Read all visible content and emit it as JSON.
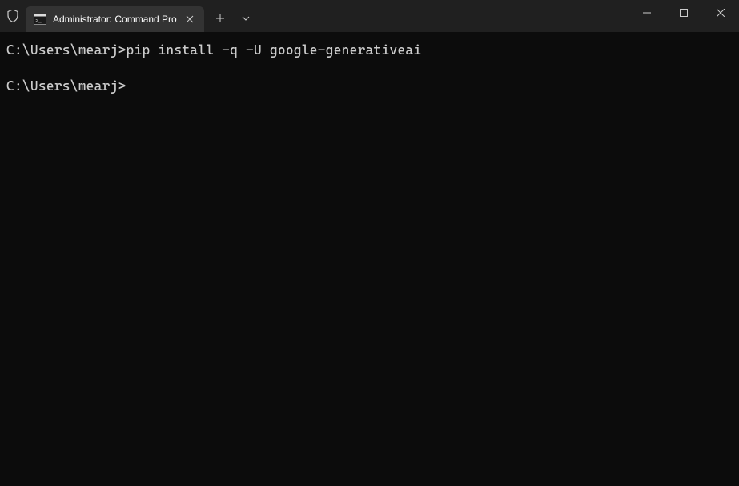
{
  "tab": {
    "title": "Administrator: Command Pro"
  },
  "terminal": {
    "lines": [
      {
        "prompt": "C:\\Users\\mearj>",
        "command": "pip install -q -U google-generativeai"
      },
      {
        "prompt": "",
        "command": ""
      },
      {
        "prompt": "C:\\Users\\mearj>",
        "command": "",
        "cursor": true
      }
    ]
  }
}
